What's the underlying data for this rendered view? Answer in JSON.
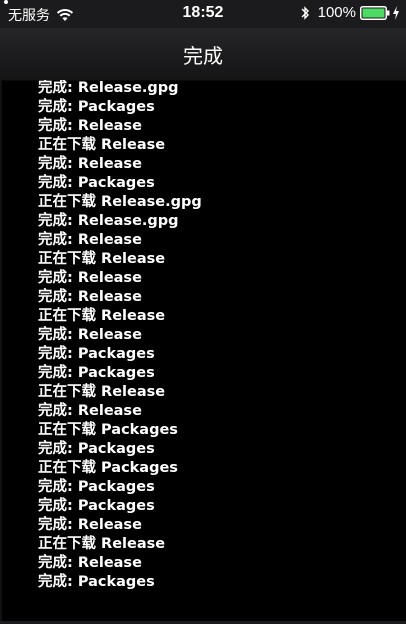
{
  "status_bar": {
    "carrier": "无服务",
    "time": "18:52",
    "battery_percent": "100%",
    "battery_level": 1.0,
    "icons": [
      "wifi-icon",
      "bluetooth-icon",
      "battery-icon",
      "charging-bolt-icon"
    ]
  },
  "nav": {
    "title": "完成"
  },
  "log": {
    "lines": [
      "完成: Release.gpg",
      "完成: Packages",
      "完成: Release",
      "正在下载 Release",
      "完成: Release",
      "完成: Packages",
      "正在下载 Release.gpg",
      "完成: Release.gpg",
      "完成: Release",
      "正在下载 Release",
      "完成: Release",
      "完成: Release",
      "正在下载 Release",
      "完成: Release",
      "完成: Packages",
      "完成: Packages",
      "正在下载 Release",
      "完成: Release",
      "正在下载 Packages",
      "完成: Packages",
      "正在下载 Packages",
      "完成: Packages",
      "完成: Packages",
      "完成: Release",
      "正在下载 Release",
      "完成: Release",
      "完成: Packages"
    ]
  },
  "colors": {
    "background": "#000000",
    "bar": "#1b1b1d",
    "text": "#ffffff",
    "battery_fill": "#4cd964"
  }
}
